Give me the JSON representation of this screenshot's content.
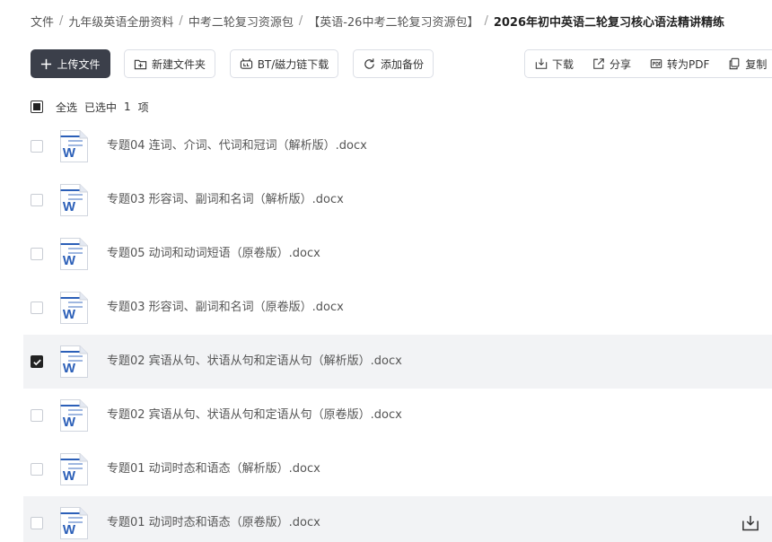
{
  "breadcrumb": {
    "items": [
      "文件",
      "九年级英语全册资料",
      "中考二轮复习资源包",
      "【英语-26中考二轮复习资源包】"
    ],
    "current": "2026年初中英语二轮复习核心语法精讲精练"
  },
  "toolbar": {
    "upload_label": "上传文件",
    "new_folder_label": "新建文件夹",
    "bt_label": "BT/磁力链下载",
    "backup_label": "添加备份",
    "download_label": "下载",
    "share_label": "分享",
    "pdf_label": "转为PDF",
    "copy_label": "复制"
  },
  "selection": {
    "select_all_label": "全选",
    "selected_prefix": "已选中",
    "selected_count": "1",
    "selected_suffix": "项"
  },
  "file_icon_letter": "W",
  "colors": {
    "word_blue": "#2b5fb8",
    "primary_button": "#3b3f4a",
    "row_highlight": "#f2f3f5"
  },
  "files": [
    {
      "name": "专题04 连词、介词、代词和冠词（解析版）.docx",
      "checked": false
    },
    {
      "name": "专题03 形容词、副词和名词（解析版）.docx",
      "checked": false
    },
    {
      "name": "专题05 动词和动词短语（原卷版）.docx",
      "checked": false
    },
    {
      "name": "专题03 形容词、副词和名词（原卷版）.docx",
      "checked": false
    },
    {
      "name": "专题02 宾语从句、状语从句和定语从句（解析版）.docx",
      "checked": true
    },
    {
      "name": "专题02 宾语从句、状语从句和定语从句（原卷版）.docx",
      "checked": false
    },
    {
      "name": "专题01 动词时态和语态（解析版）.docx",
      "checked": false
    },
    {
      "name": "专题01 动词时态和语态（原卷版）.docx",
      "checked": false,
      "hovered": true
    }
  ]
}
